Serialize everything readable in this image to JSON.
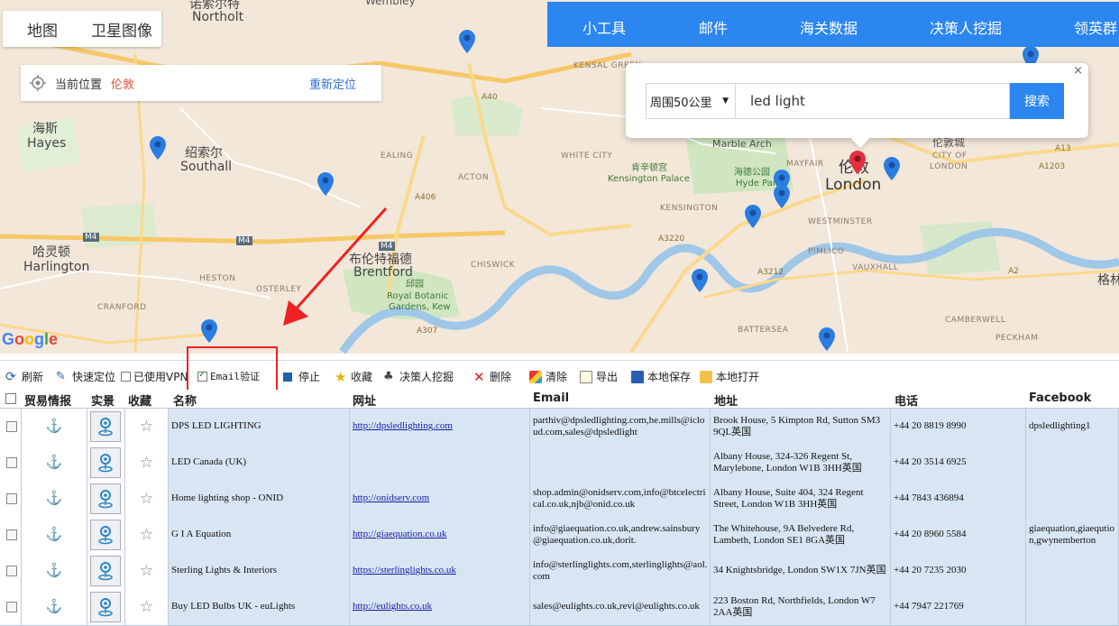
{
  "map": {
    "tabs": [
      "地图",
      "卫星图像"
    ],
    "location": {
      "label": "当前位置",
      "city": "伦敦",
      "relocate": "重新定位"
    },
    "labels": [
      {
        "t": "诺索尔特",
        "cls": "big"
      },
      {
        "t": "Northolt",
        "cls": "big"
      },
      {
        "t": "Wembley",
        "cls": ""
      },
      {
        "t": "海斯",
        "cls": "big"
      },
      {
        "t": "Hayes",
        "cls": "big"
      },
      {
        "t": "绍索尔",
        "cls": "big"
      },
      {
        "t": "Southall",
        "cls": "big"
      },
      {
        "t": "哈灵顿",
        "cls": "big"
      },
      {
        "t": "Harlington",
        "cls": "big"
      },
      {
        "t": "布伦特福德",
        "cls": "big"
      },
      {
        "t": "Brentford",
        "cls": "big"
      },
      {
        "t": "邱园",
        "cls": "park"
      },
      {
        "t": "Royal Botanic",
        "cls": "park"
      },
      {
        "t": "Gardens, Kew",
        "cls": "park"
      },
      {
        "t": "伦敦",
        "cls": "city"
      },
      {
        "t": "London",
        "cls": "city"
      },
      {
        "t": "伦敦城",
        "cls": ""
      },
      {
        "t": "CITY OF",
        "cls": "small"
      },
      {
        "t": "LONDON",
        "cls": "small"
      },
      {
        "t": "肯辛顿宫",
        "cls": "park"
      },
      {
        "t": "Kensington Palace",
        "cls": "park"
      },
      {
        "t": "海德公园",
        "cls": "park"
      },
      {
        "t": "Hyde Park",
        "cls": "park"
      },
      {
        "t": "Marble Arch",
        "cls": ""
      },
      {
        "t": "WHITE CITY",
        "cls": "small"
      },
      {
        "t": "EALING",
        "cls": "small"
      },
      {
        "t": "ACTON",
        "cls": "small"
      },
      {
        "t": "CHISWICK",
        "cls": "small"
      },
      {
        "t": "HESTON",
        "cls": "small"
      },
      {
        "t": "OSTERLEY",
        "cls": "small"
      },
      {
        "t": "CRANFORD",
        "cls": "small"
      },
      {
        "t": "KENSINGTON",
        "cls": "small"
      },
      {
        "t": "WESTMINSTER",
        "cls": "small"
      },
      {
        "t": "MAYFAIR",
        "cls": "small"
      },
      {
        "t": "BATTERSEA",
        "cls": "small"
      },
      {
        "t": "VAUXHALL",
        "cls": "small"
      },
      {
        "t": "PIMLICO",
        "cls": "small"
      },
      {
        "t": "CAMBERWELL",
        "cls": "small"
      },
      {
        "t": "PECKHAM",
        "cls": "small"
      },
      {
        "t": "KENSAL GREEN",
        "cls": "small"
      },
      {
        "t": "格林",
        "cls": "big"
      },
      {
        "t": "领英群",
        "cls": "big"
      },
      {
        "t": "M4",
        "cls": "road"
      },
      {
        "t": "A40",
        "cls": "road"
      },
      {
        "t": "A406",
        "cls": "road"
      },
      {
        "t": "A3220",
        "cls": "road"
      },
      {
        "t": "A3212",
        "cls": "road"
      },
      {
        "t": "A13",
        "cls": "road"
      },
      {
        "t": "A1203",
        "cls": "road"
      },
      {
        "t": "A2",
        "cls": "road"
      },
      {
        "t": "A307",
        "cls": "road"
      }
    ]
  },
  "topnav": [
    "小工具",
    "邮件",
    "海关数据",
    "决策人挖掘",
    "领英群"
  ],
  "search": {
    "radius": "周围50公里",
    "keyword": "led light",
    "button": "搜索",
    "close": "×"
  },
  "google": "Google",
  "toolbar": {
    "refresh": "刷新",
    "quick_locate": "快速定位",
    "used_vpn": "已使用VPN",
    "email_verify": "Email验证",
    "stop": "停止",
    "favorite": "收藏",
    "dm_mining": "决策人挖掘",
    "delete": "删除",
    "clear": "清除",
    "export": "导出",
    "save_local": "本地保存",
    "open_local": "本地打开"
  },
  "table": {
    "headers": [
      "贸易情报",
      "实景",
      "收藏",
      "名称",
      "网址",
      "Email",
      "地址",
      "电话",
      "Facebook"
    ],
    "rows": [
      {
        "name": "DPS LED LIGHTING",
        "url": "http://dpsledlighting.com",
        "email": "parthiv@dpsledlighting.com,he.mills@icloud.com,sales@dpsledlight",
        "address": "Brook House, 5 Kimpton Rd, Sutton SM3 9QL英国",
        "phone": "+44 20 8819 8990",
        "facebook": "dpsledlighting1",
        "trade_highlight": true
      },
      {
        "name": "LED Canada (UK)",
        "url": "",
        "email": "",
        "address": "Albany House, 324-326 Regent St, Marylebone, London W1B 3HH英国",
        "phone": "+44 20 3514 6925",
        "facebook": "",
        "trade_highlight": false
      },
      {
        "name": "Home lighting shop - ONID",
        "url": "http://onidserv.com",
        "email": "shop.admin@onidserv.com,info@btcelectrical.co.uk,njb@onid.co.uk",
        "address": "Albany House, Suite 404, 324 Regent Street, London W1B 3HH英国",
        "phone": "+44 7843 436894",
        "facebook": "",
        "trade_highlight": false
      },
      {
        "name": "G I A Equation",
        "url": "http://giaequation.co.uk",
        "email": "info@giaequation.co.uk,andrew.sainsbury@giaequation.co.uk,dorit.",
        "address": "The Whitehouse, 9A Belvedere Rd, Lambeth, London SE1 8GA英国",
        "phone": "+44 20 8960 5584",
        "facebook": "giaequation,giaeqution,gwynemberton",
        "trade_highlight": false
      },
      {
        "name": "Sterling Lights & Interiors",
        "url": "https://sterlinglights.co.uk",
        "email": "info@sterlinglights.com,sterlinglights@aol.com",
        "address": "34 Knightsbridge, London SW1X 7JN英国",
        "phone": "+44 20 7235 2030",
        "facebook": "",
        "trade_highlight": false
      },
      {
        "name": "Buy LED Bulbs UK - euLights",
        "url": "http://eulights.co.uk",
        "email": "sales@eulights.co.uk,revi@eulights.co.uk",
        "address": "223 Boston Rd, Northfields, London W7 2AA英国",
        "phone": "+44 7947 221769",
        "facebook": "",
        "trade_highlight": false
      }
    ]
  },
  "colors": {
    "accent": "#2b86f0",
    "pin": "#2a7de1",
    "pin_active": "#e0313d",
    "highlight_box": "#ee2222"
  }
}
